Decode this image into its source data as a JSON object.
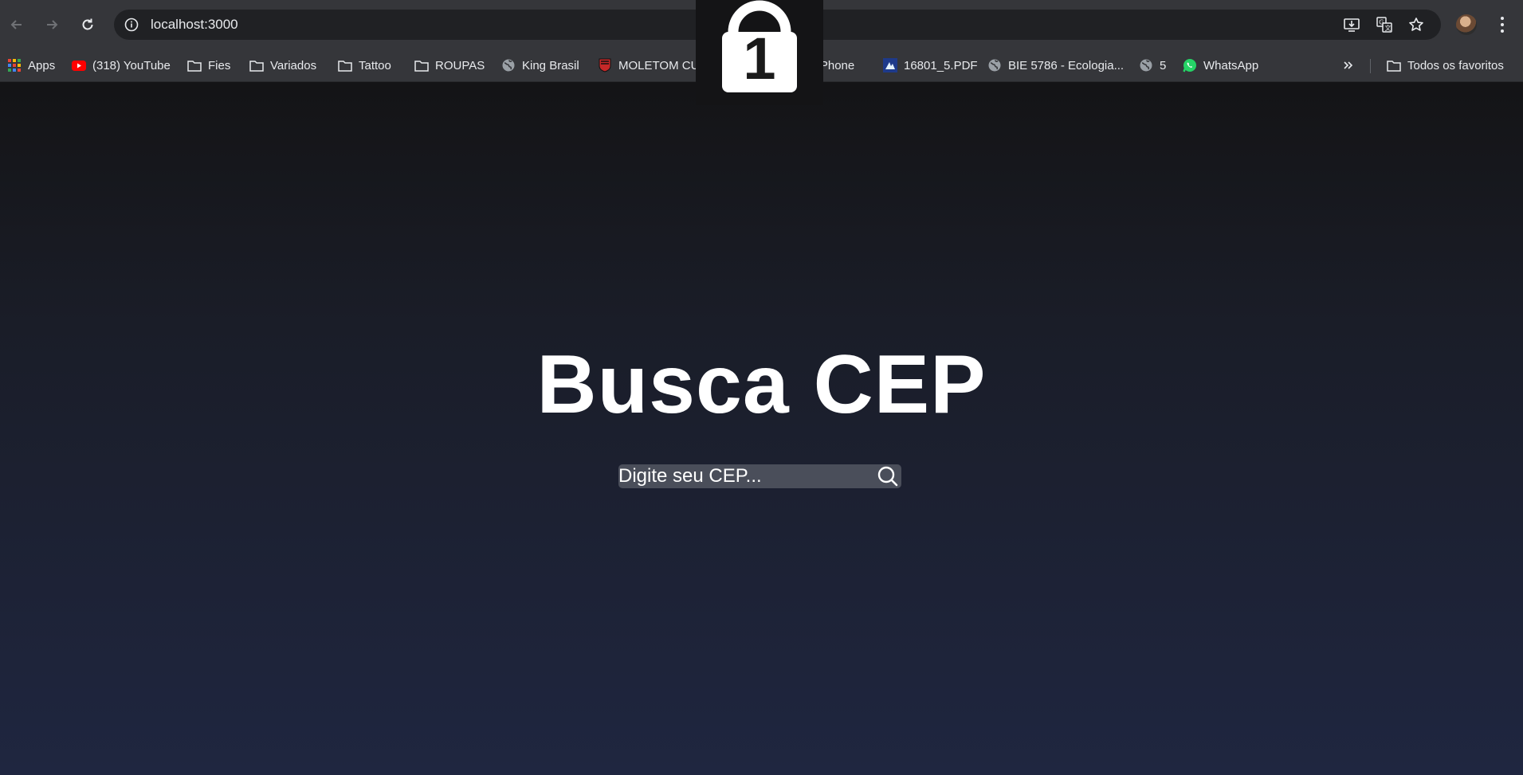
{
  "browser": {
    "url": "localhost:3000"
  },
  "bookmarks": {
    "items": [
      {
        "label": "Apps",
        "icon": "apps-grid-icon"
      },
      {
        "label": "(318) YouTube",
        "icon": "youtube-icon"
      },
      {
        "label": "Fies",
        "icon": "folder-icon"
      },
      {
        "label": "Variados",
        "icon": "folder-icon"
      },
      {
        "label": "Tattoo",
        "icon": "folder-icon"
      },
      {
        "label": "ROUPAS",
        "icon": "folder-icon"
      },
      {
        "label": "King Brasil",
        "icon": "globe-icon"
      },
      {
        "label": "MOLETOM CUSTO...",
        "icon": "crest-icon"
      },
      {
        "label": "r meu iPhone",
        "icon": "apple-icon"
      },
      {
        "label": "16801_5.PDF",
        "icon": "pdf-icon"
      },
      {
        "label": "BIE 5786 - Ecologia...",
        "icon": "globe-icon"
      },
      {
        "label": "5",
        "icon": "globe-icon"
      },
      {
        "label": "WhatsApp",
        "icon": "whatsapp-icon"
      }
    ],
    "all_bookmarks_label": "Todos os favoritos"
  },
  "overlay": {
    "lock_number": "1"
  },
  "page": {
    "title": "Busca CEP",
    "search_placeholder": "Digite seu CEP..."
  },
  "colors": {
    "toolbar": "#35363a",
    "omnibox": "#202124",
    "page_top": "#141416",
    "page_bottom": "#1f2640",
    "search_bg": "#4a4e5a",
    "text": "#ffffff"
  }
}
